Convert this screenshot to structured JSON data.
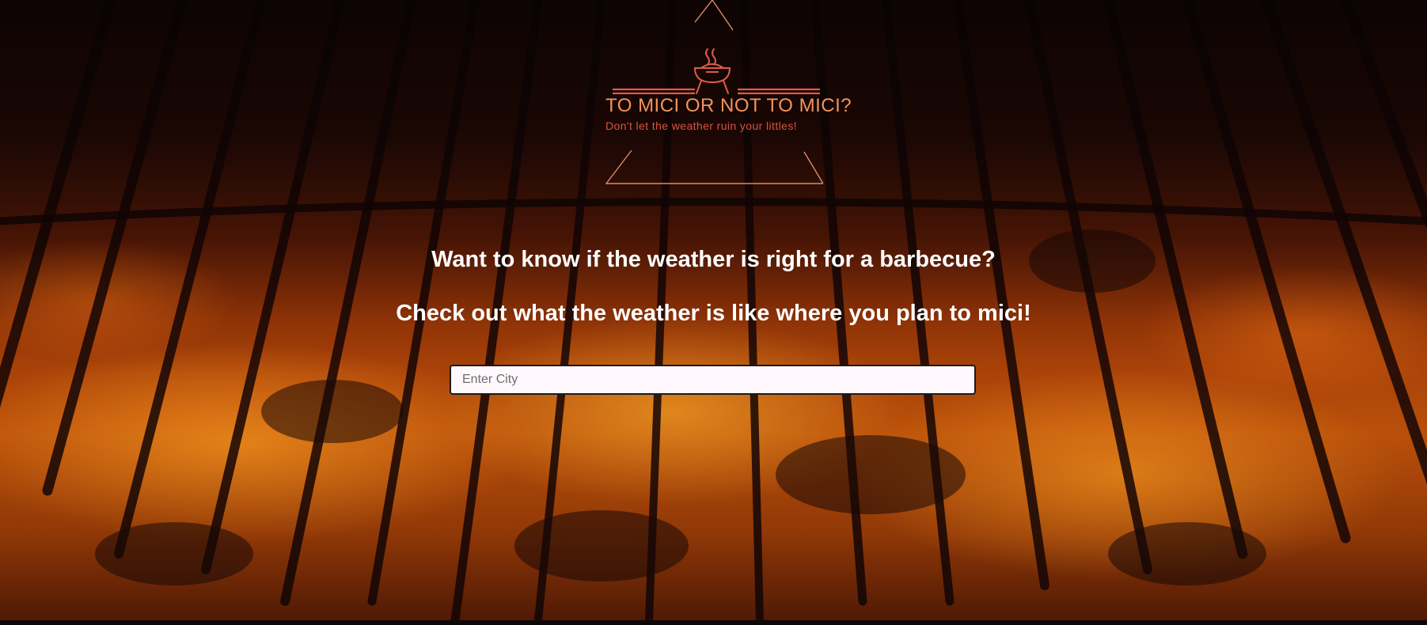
{
  "logo": {
    "title": "TO MICI OR NOT TO MICI?",
    "tagline": "Don't let the weather ruin your littles!",
    "icon": "grill-icon",
    "colors": {
      "title": "#f1945c",
      "tagline": "#d9533f",
      "frame": "#e0886a"
    }
  },
  "main": {
    "question": "Want to know if the weather is right for a barbecue?",
    "prompt": "Check out what the weather is like where you plan to mici!"
  },
  "search": {
    "placeholder": "Enter City",
    "value": ""
  },
  "background": {
    "description_icon": "grill-fire-background"
  }
}
